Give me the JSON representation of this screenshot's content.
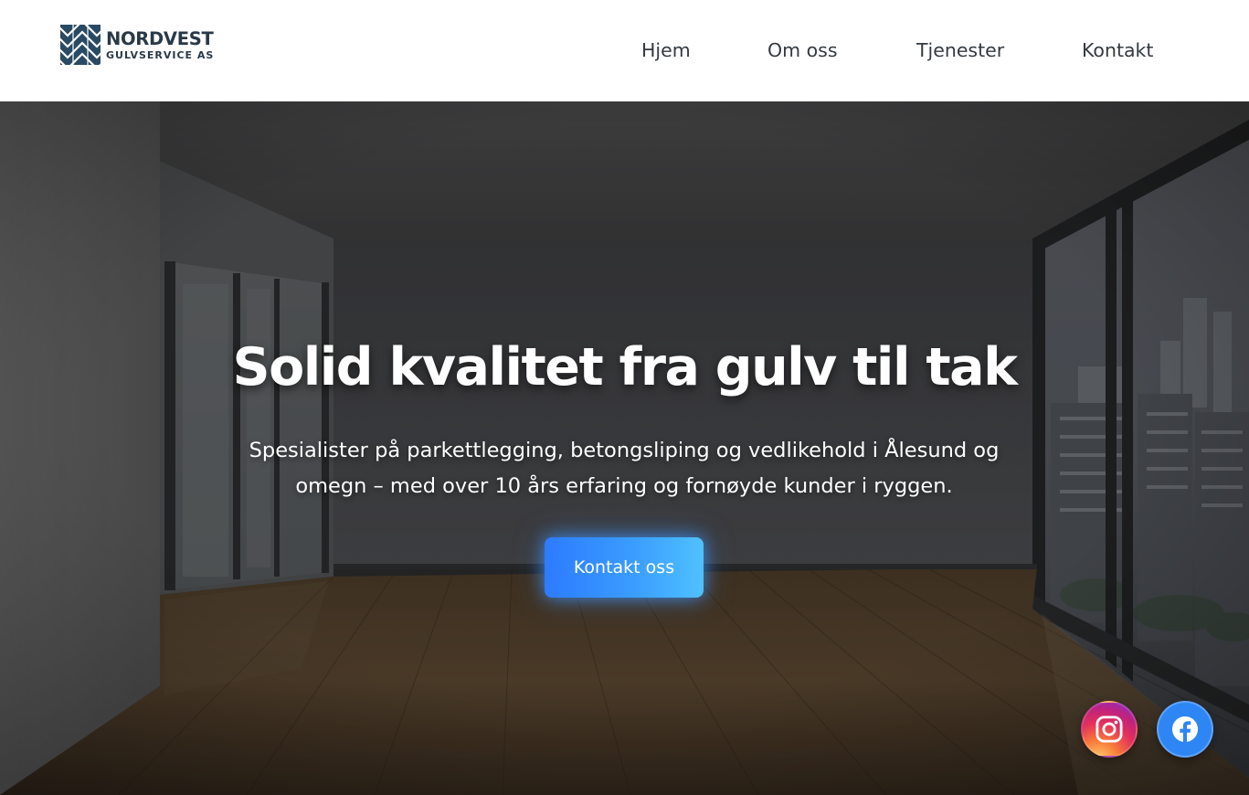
{
  "header": {
    "logo": {
      "name": "NORDVEST",
      "subtitle": "GULVSERVICE AS",
      "icon": "parquet-logo-icon"
    },
    "nav": [
      {
        "label": "Hjem"
      },
      {
        "label": "Om oss"
      },
      {
        "label": "Tjenester"
      },
      {
        "label": "Kontakt"
      }
    ]
  },
  "hero": {
    "title": "Solid kvalitet fra gulv til tak",
    "subtitle_line1": "Spesialister på parkettlegging, betongsliping og vedlikehold i Ålesund og",
    "subtitle_line2": "omegn – med over 10 års erfaring og fornøyde kunder i ryggen.",
    "cta_label": "Kontakt oss",
    "background": "empty-room-with-wooden-floor-and-windows"
  },
  "social": [
    {
      "name": "Instagram",
      "icon": "instagram-icon"
    },
    {
      "name": "Facebook",
      "icon": "facebook-icon"
    }
  ],
  "colors": {
    "brand_dark": "#2a3947",
    "nav_text": "#333a40",
    "cta_start": "#2d7bff",
    "cta_end": "#4fc1ff",
    "facebook_blue": "#2e86f5"
  }
}
